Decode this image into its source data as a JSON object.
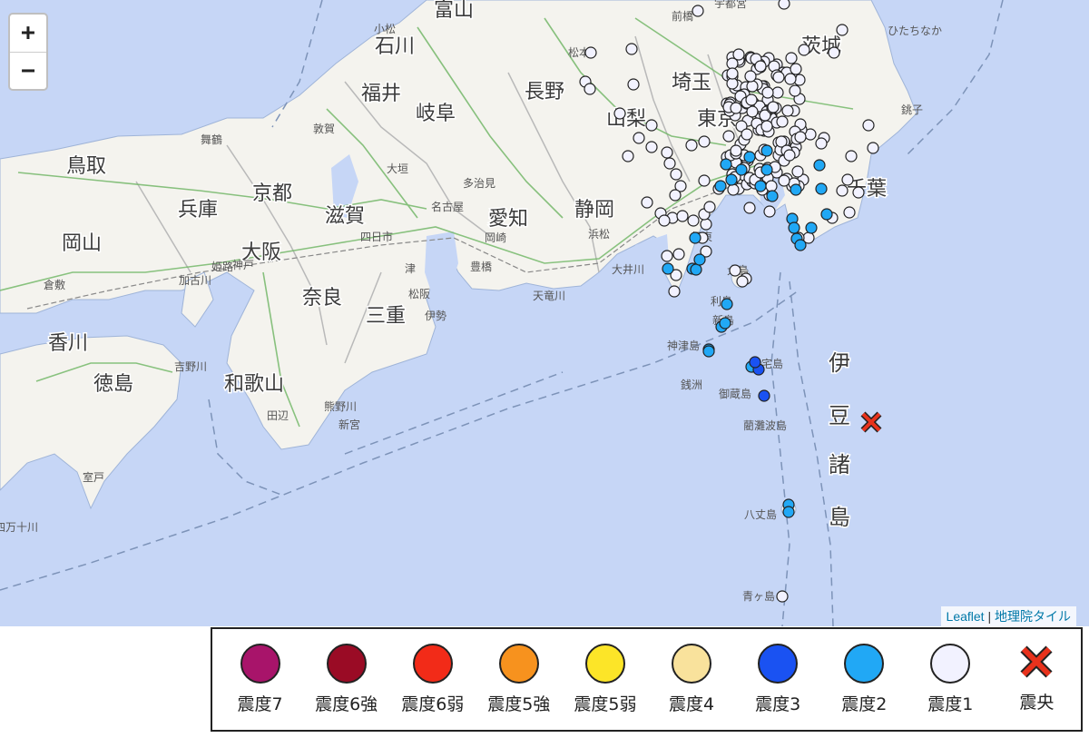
{
  "map": {
    "zoom_in_label": "+",
    "zoom_out_label": "−",
    "attribution": {
      "leaflet": "Leaflet",
      "separator": "|",
      "tiles": "地理院タイル"
    },
    "colors": {
      "sea": "#c6d6f6",
      "land": "#f4f3ee",
      "intensity1": "#f2f2ff",
      "intensity2": "#21a8f5",
      "intensity3": "#1a52f2"
    },
    "place_labels": [
      {
        "t": "富山"
      },
      {
        "t": "石川"
      },
      {
        "t": "小松"
      },
      {
        "t": "福井"
      },
      {
        "t": "岐阜"
      },
      {
        "t": "長野"
      },
      {
        "t": "松本"
      },
      {
        "t": "埼玉"
      },
      {
        "t": "山梨"
      },
      {
        "t": "東京"
      },
      {
        "t": "千葉"
      },
      {
        "t": "茨城"
      },
      {
        "t": "ひたちなか"
      },
      {
        "t": "銚子"
      },
      {
        "t": "前橋"
      },
      {
        "t": "宇都宮"
      },
      {
        "t": "鳥取"
      },
      {
        "t": "京都"
      },
      {
        "t": "兵庫"
      },
      {
        "t": "滋賀"
      },
      {
        "t": "大阪"
      },
      {
        "t": "奈良"
      },
      {
        "t": "三重"
      },
      {
        "t": "愛知"
      },
      {
        "t": "名古屋"
      },
      {
        "t": "静岡"
      },
      {
        "t": "岡山"
      },
      {
        "t": "香川"
      },
      {
        "t": "徳島"
      },
      {
        "t": "和歌山"
      },
      {
        "t": "伊東"
      },
      {
        "t": "大島"
      },
      {
        "t": "利島"
      },
      {
        "t": "新島"
      },
      {
        "t": "神津島"
      },
      {
        "t": "三宅島"
      },
      {
        "t": "御蔵島"
      },
      {
        "t": "銭洲"
      },
      {
        "t": "藺灘波島"
      },
      {
        "t": "八丈島"
      },
      {
        "t": "青ヶ島"
      },
      {
        "t": "伊"
      },
      {
        "t": "豆"
      },
      {
        "t": "諸"
      },
      {
        "t": "島"
      },
      {
        "t": "敦賀"
      },
      {
        "t": "舞鶴"
      },
      {
        "t": "大垣"
      },
      {
        "t": "多治見"
      },
      {
        "t": "岡崎"
      },
      {
        "t": "豊橋"
      },
      {
        "t": "浜松"
      },
      {
        "t": "四日市"
      },
      {
        "t": "津"
      },
      {
        "t": "松阪"
      },
      {
        "t": "伊勢"
      },
      {
        "t": "神戸"
      },
      {
        "t": "加古川"
      },
      {
        "t": "姫路"
      },
      {
        "t": "倉敷"
      },
      {
        "t": "田辺"
      },
      {
        "t": "新宮"
      },
      {
        "t": "室戸"
      },
      {
        "t": "大井川"
      },
      {
        "t": "天竜川"
      },
      {
        "t": "吉野川"
      },
      {
        "t": "熊野川"
      },
      {
        "t": "四万十川"
      }
    ]
  },
  "legend": {
    "items": [
      {
        "label": "震度7",
        "color": "#a8146a",
        "kind": "circle"
      },
      {
        "label": "震度6強",
        "color": "#9a0b25",
        "kind": "circle"
      },
      {
        "label": "震度6弱",
        "color": "#f22b18",
        "kind": "circle"
      },
      {
        "label": "震度5強",
        "color": "#f7921e",
        "kind": "circle"
      },
      {
        "label": "震度5弱",
        "color": "#fce528",
        "kind": "circle"
      },
      {
        "label": "震度4",
        "color": "#f9e29c",
        "kind": "circle"
      },
      {
        "label": "震度3",
        "color": "#1a52f2",
        "kind": "circle"
      },
      {
        "label": "震度2",
        "color": "#21a8f5",
        "kind": "circle"
      },
      {
        "label": "震度1",
        "color": "#f2f2ff",
        "kind": "circle"
      },
      {
        "label": "震央",
        "color": "#e8321c",
        "kind": "cross"
      }
    ]
  }
}
